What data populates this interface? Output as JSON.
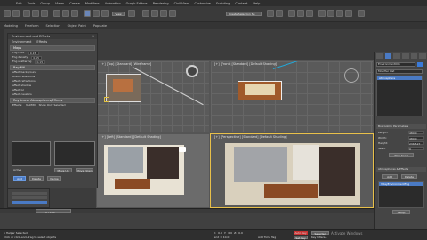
{
  "menubar": {
    "items": [
      "Edit",
      "Tools",
      "Group",
      "Views",
      "Create",
      "Modifiers",
      "Animation",
      "Graph Editors",
      "Rendering",
      "Civil View",
      "Customize",
      "Scripting",
      "Content",
      "Help"
    ]
  },
  "toolbar": {
    "view_dropdown": "View",
    "create_selection_set": "Create Selection Se"
  },
  "ribbon": {
    "tabs": [
      "Modeling",
      "Freeform",
      "Selection",
      "Object Paint",
      "Populate"
    ]
  },
  "viewports": {
    "top": {
      "label": "[+] [Top] [Standard] [Wireframe]"
    },
    "front": {
      "label": "[+] [Front] [Standard] [Default Shading]"
    },
    "left": {
      "label": "[+] [Left] [Standard] [Default Shading]"
    },
    "perspective": {
      "label": "[+] [Perspective] [Standard] [Default Shading]"
    }
  },
  "env_dialog": {
    "title": "Environment and Effects",
    "tabs": [
      "Environment",
      "Effects"
    ],
    "sections": {
      "maps": "Maps",
      "ray_mtl": "Ray Mtl",
      "raytrace_atmosphere": "Ray tracer Atmospheres/Effects"
    },
    "maps_rows": [
      {
        "label": "Fog color",
        "value": "0.15"
      },
      {
        "label": "Fog density",
        "value": "0.15"
      },
      {
        "label": "Fog scattering",
        "value": "0.15"
      }
    ],
    "raymtl_rows": [
      "affect background",
      "affect reflections",
      "affect refractions",
      "affect shadow",
      "affect GI",
      "affect caustics"
    ],
    "effects_labels": [
      "Effects:",
      "NullMtl",
      "Show Only Selected"
    ],
    "add_button": "Add",
    "delete_button": "Delete",
    "active_label": "Active",
    "move_up": "Move Up",
    "move_down": "Move Down",
    "merge_button": "Merge"
  },
  "command_panel": {
    "object_name": "Environment001",
    "modifier_list": "Modifier List",
    "stack_item": "Atmosphere",
    "rollout_params": "Box Gizmo Parameters",
    "param_rows": [
      {
        "label": "Length:",
        "value": "480.0"
      },
      {
        "label": "Width:",
        "value": "480.0"
      },
      {
        "label": "Height:",
        "value": "236.527"
      },
      {
        "label": "Seed:",
        "value": "0"
      }
    ],
    "new_seed": "New Seed",
    "rollout_atmos": "Atmospheres & Effects",
    "atmos_add": "Add",
    "atmos_delete": "Delete",
    "atmos_item": "VRayEnvironmentFog",
    "setup_button": "Setup"
  },
  "timeline": {
    "frame": "0 / 100"
  },
  "status": {
    "selected": "1 Helper Selected",
    "hint": "Click or click-and-drag to select objects",
    "x_label": "X:",
    "x_value": "0.0",
    "y_label": "Y:",
    "y_value": "0.0",
    "z_label": "Z:",
    "z_value": "0.0",
    "grid": "Grid = 10.0",
    "add_time_tag": "Add Time Tag",
    "auto_key": "Auto Key",
    "set_key": "Set Key",
    "selected_dropdown": "Selected",
    "key_filters": "Key Filters...",
    "activate_windows": "Activate Windows"
  },
  "colors": {
    "accent": "#4a7ac4",
    "viewport_border_active": "#e8c04a",
    "light_cyan": "#23a8d8"
  }
}
